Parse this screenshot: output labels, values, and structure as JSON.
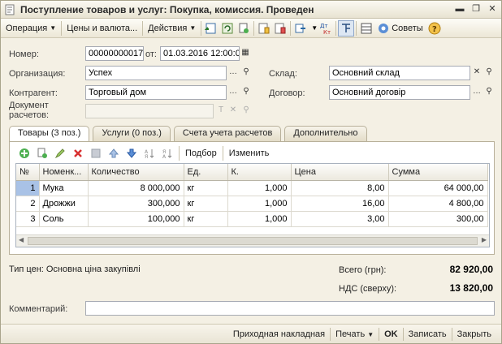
{
  "window": {
    "title": "Поступление товаров и услуг: Покупка, комиссия. Проведен"
  },
  "toolbar": {
    "operation": "Операция",
    "prices": "Цены и валюта...",
    "actions": "Действия",
    "tips": "Советы"
  },
  "header": {
    "number_label": "Номер:",
    "number_value": "00000000017",
    "from_label": "от:",
    "date_value": "01.03.2016 12:00:0",
    "org_label": "Организация:",
    "org_value": "Успех",
    "warehouse_label": "Склад:",
    "warehouse_value": "Основний склад",
    "contractor_label": "Контрагент:",
    "contractor_value": "Торговый дом",
    "contract_label": "Договор:",
    "contract_value": "Основний договір",
    "settlement_doc_label_1": "Документ",
    "settlement_doc_label_2": "расчетов:",
    "settlement_doc_value": ""
  },
  "tabs": [
    "Товары (3 поз.)",
    "Услуги (0 поз.)",
    "Счета учета расчетов",
    "Дополнительно"
  ],
  "panel_toolbar": {
    "pick": "Подбор",
    "change": "Изменить"
  },
  "table": {
    "columns": [
      "№",
      "Номенк...",
      "Количество",
      "Ед.",
      "К.",
      "Цена",
      "Сумма"
    ],
    "rows": [
      [
        "1",
        "Мука",
        "8 000,000",
        "кг",
        "1,000",
        "8,00",
        "64 000,00"
      ],
      [
        "2",
        "Дрожжи",
        "300,000",
        "кг",
        "1,000",
        "16,00",
        "4 800,00"
      ],
      [
        "3",
        "Соль",
        "100,000",
        "кг",
        "1,000",
        "3,00",
        "300,00"
      ]
    ]
  },
  "footer": {
    "price_type": "Тип цен: Основна ціна закупівлі",
    "total_label": "Всего (грн):",
    "total_value": "82 920,00",
    "vat_label": "НДС (сверху):",
    "vat_value": "13 820,00",
    "comment_label": "Комментарий:",
    "comment_value": ""
  },
  "bottombar": {
    "invoice": "Приходная накладная",
    "print": "Печать",
    "ok": "OK",
    "save": "Записать",
    "close": "Закрыть"
  }
}
